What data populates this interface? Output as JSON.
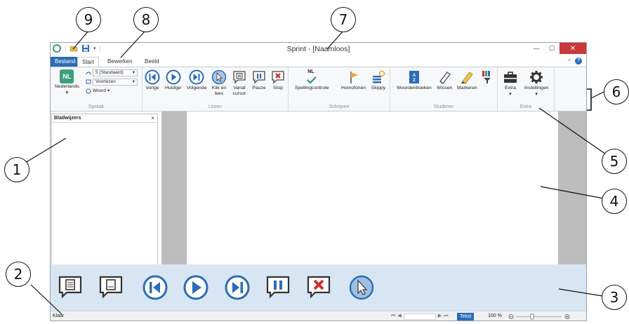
{
  "window": {
    "title": "Sprint - [Naamloos]"
  },
  "tabs": {
    "file": "Bestand",
    "start": "Start",
    "edit": "Bewerken",
    "view": "Beeld"
  },
  "ribbon": {
    "speech": {
      "group_label": "Spraak",
      "language_badge": "NL",
      "language_label": "Nederlands",
      "speed_value": "5 (Standaard)",
      "mode_value": "Voorlezen",
      "unit_value": "Woord"
    },
    "read": {
      "group_label": "Lezen",
      "buttons": [
        "Vorige",
        "Huidige",
        "Volgende",
        "Klik en lees",
        "Vanaf cursor",
        "Pauze",
        "Stop"
      ]
    },
    "write": {
      "group_label": "Schrijven",
      "buttons": [
        "Spellingcontrole",
        "Homofonen",
        "Skippy"
      ],
      "spell_badge": "NL"
    },
    "study": {
      "group_label": "Studeren",
      "buttons": [
        "Woordenboeken",
        "Wissen",
        "Markeren"
      ]
    },
    "extra": {
      "group_label": "Extra",
      "buttons": [
        "Extra",
        "Instellingen"
      ]
    }
  },
  "bookmarks": {
    "title": "Bladwijzers",
    "close": "×"
  },
  "status": {
    "text": "Klaar",
    "mode": "Tekst",
    "zoom": "100 %"
  },
  "callouts": [
    "1",
    "2",
    "3",
    "4",
    "5",
    "6",
    "7",
    "8",
    "9"
  ],
  "colors": {
    "accent": "#2b6cb7",
    "close": "#c7393a",
    "floatbar": "#d8e6f3",
    "nl_green": "#3c9f7c"
  }
}
